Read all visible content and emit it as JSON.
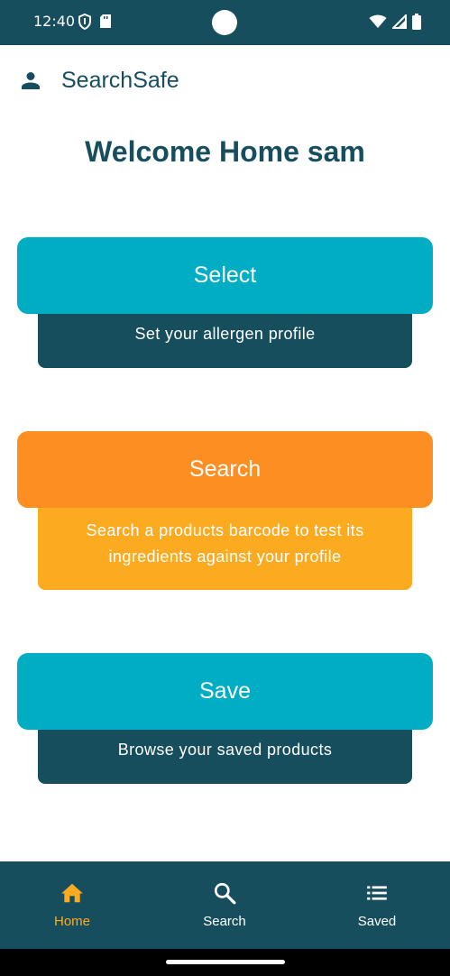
{
  "status_bar": {
    "time": "12:40",
    "icons": [
      "shield-icon",
      "sd-card-icon",
      "wifi-icon",
      "signal-icon",
      "battery-icon"
    ]
  },
  "app_bar": {
    "title": "SearchSafe",
    "icon": "person-icon"
  },
  "welcome": "Welcome Home sam",
  "cards": {
    "select": {
      "button_label": "Select",
      "description": "Set your allergen profile"
    },
    "search": {
      "button_label": "Search",
      "description": "Search a products barcode to test its ingredients against your profile"
    },
    "save": {
      "button_label": "Save",
      "description": "Browse your saved products"
    }
  },
  "bottom_nav": {
    "items": [
      {
        "label": "Home",
        "icon": "home-icon",
        "active": true
      },
      {
        "label": "Search",
        "icon": "search-icon",
        "active": false
      },
      {
        "label": "Saved",
        "icon": "list-icon",
        "active": false
      }
    ]
  },
  "colors": {
    "primary_dark": "#174e5e",
    "teal": "#01adc3",
    "orange": "#fd8e21",
    "amber": "#fcab21",
    "active_nav": "#fcab21"
  }
}
